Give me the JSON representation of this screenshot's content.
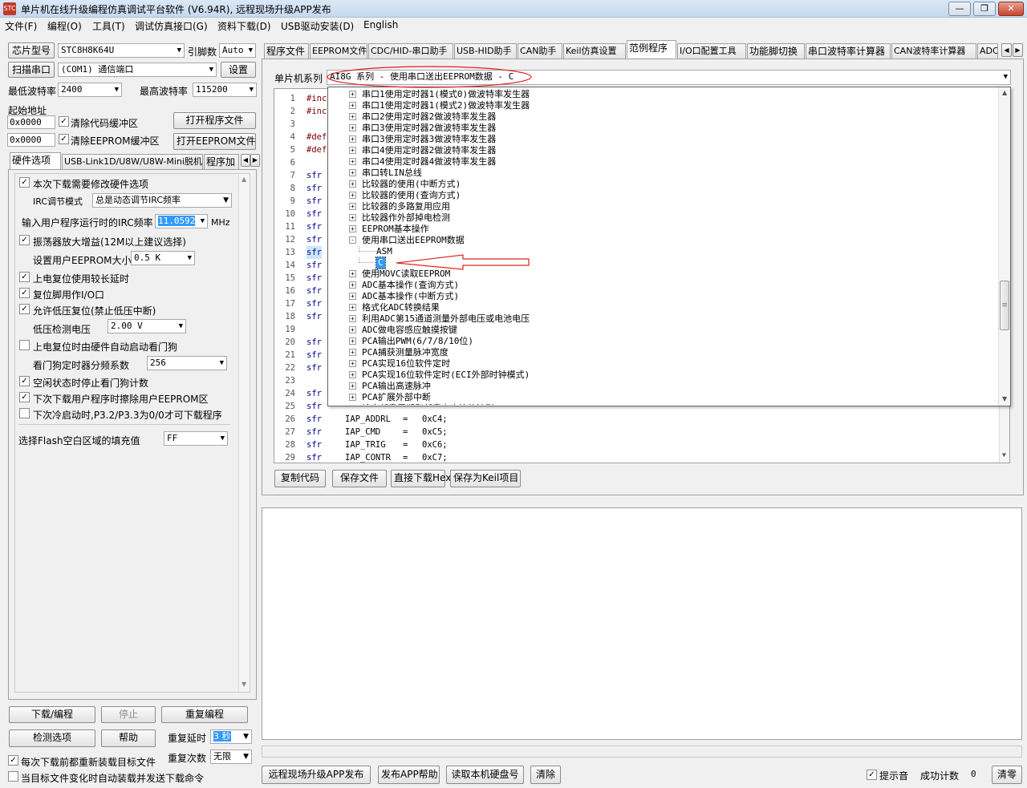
{
  "window": {
    "title": "单片机在线升级编程仿真调试平台软件 (V6.94R), 远程现场升级APP发布",
    "icon": "stc-app-icon"
  },
  "menu": [
    "文件(F)",
    "编程(O)",
    "工具(T)",
    "调试仿真接口(G)",
    "资料下载(D)",
    "USB驱动安装(D)",
    "English"
  ],
  "left": {
    "chip_label": "芯片型号",
    "chip_value": "STC8H8K64U",
    "pins_label": "引脚数",
    "pins_value": "Auto",
    "scan_label": "扫描串口",
    "port_value": "(COM1) 通信端口",
    "settings_label": "设置",
    "min_baud_label": "最低波特率",
    "min_baud": "2400",
    "max_baud_label": "最高波特率",
    "max_baud": "115200",
    "start_addr_label": "起始地址",
    "addr1": "0x0000",
    "clear_code": "清除代码缓冲区",
    "open_prog": "打开程序文件",
    "addr2": "0x0000",
    "clear_eeprom": "清除EEPROM缓冲区",
    "open_eeprom": "打开EEPROM文件",
    "tabs": [
      "硬件选项",
      "USB-Link1D/U8W/U8W-Mini脱机",
      "程序加"
    ],
    "opt_modify": "本次下载需要修改硬件选项",
    "irc_mode_label": "IRC调节模式",
    "irc_mode": "总是动态调节IRC频率",
    "irc_freq_label": "输入用户程序运行时的IRC频率",
    "irc_freq": "11.0592",
    "mhz": "MHz",
    "osc_gain": "振荡器放大增益(12M以上建议选择)",
    "eeprom_size_label": "设置用户EEPROM大小",
    "eeprom_size": "0.5 K",
    "opt_long_delay": "上电复位使用较长延时",
    "opt_reset_io": "复位脚用作I/O口",
    "opt_lvr": "允许低压复位(禁止低压中断)",
    "lvd_label": "低压检测电压",
    "lvd": "2.00 V",
    "opt_wdt": "上电复位时由硬件自动启动看门狗",
    "wdt_div_label": "看门狗定时器分频系数",
    "wdt_div": "256",
    "opt_idle_wdt": "空闲状态时停止看门狗计数",
    "opt_erase_eeprom": "下次下载用户程序时擦除用户EEPROM区",
    "opt_p32": "下次冷启动时,P3.2/P3.3为0/0才可下载程序",
    "fill_label": "选择Flash空白区域的填充值",
    "fill": "FF",
    "download": "下载/编程",
    "stop": "停止",
    "reprogram": "重复编程",
    "check": "检测选项",
    "help": "帮助",
    "repeat_delay_label": "重复延时",
    "repeat_delay": "3 秒",
    "repeat_count_label": "重复次数",
    "repeat_count": "无限",
    "reload_each": "每次下载前都重新装载目标文件",
    "auto_reload": "当目标文件变化时自动装载并发送下载命令"
  },
  "right_tabs": [
    "程序文件",
    "EEPROM文件",
    "CDC/HID-串口助手",
    "USB-HID助手",
    "CAN助手",
    "Keil仿真设置",
    "范例程序",
    "I/O口配置工具",
    "功能脚切换",
    "串口波特率计算器",
    "CAN波特率计算器",
    "ADC"
  ],
  "examples": {
    "series_label": "单片机系列",
    "series_value": "AI8G 系列 - 使用串口送出EEPROM数据 - C",
    "tree": [
      {
        "t": "串口1使用定时器1(模式0)做波特率发生器",
        "exp": "+"
      },
      {
        "t": "串口1使用定时器1(模式2)做波特率发生器",
        "exp": "+"
      },
      {
        "t": "串口2使用定时器2做波特率发生器",
        "exp": "+"
      },
      {
        "t": "串口3使用定时器2做波特率发生器",
        "exp": "+"
      },
      {
        "t": "串口3使用定时器3做波特率发生器",
        "exp": "+"
      },
      {
        "t": "串口4使用定时器2做波特率发生器",
        "exp": "+"
      },
      {
        "t": "串口4使用定时器4做波特率发生器",
        "exp": "+"
      },
      {
        "t": "串口转LIN总线",
        "exp": "+"
      },
      {
        "t": "比较器的使用(中断方式)",
        "exp": "+"
      },
      {
        "t": "比较器的使用(查询方式)",
        "exp": "+"
      },
      {
        "t": "比较器的多路复用应用",
        "exp": "+"
      },
      {
        "t": "比较器作外部掉电检测",
        "exp": "+"
      },
      {
        "t": "EEPROM基本操作",
        "exp": "+"
      },
      {
        "t": "使用串口送出EEPROM数据",
        "exp": "-"
      },
      {
        "t": "ASM",
        "exp": "",
        "child": true
      },
      {
        "t": "C",
        "exp": "",
        "child": true,
        "sel": true
      },
      {
        "t": "使用MOVC读取EEPROM",
        "exp": "+"
      },
      {
        "t": "ADC基本操作(查询方式)",
        "exp": "+"
      },
      {
        "t": "ADC基本操作(中断方式)",
        "exp": "+"
      },
      {
        "t": "格式化ADC转换结果",
        "exp": "+"
      },
      {
        "t": "利用ADC第15通道测量外部电压或电池电压",
        "exp": "+"
      },
      {
        "t": "ADC做电容感应触摸按键",
        "exp": "+"
      },
      {
        "t": "PCA输出PWM(6/7/8/10位)",
        "exp": "+"
      },
      {
        "t": "PCA捕获测量脉冲宽度",
        "exp": "+"
      },
      {
        "t": "PCA实现16位软件定时",
        "exp": "+"
      },
      {
        "t": "PCA实现16位软件定时(ECI外部时钟模式)",
        "exp": "+"
      },
      {
        "t": "PCA输出高速脉冲",
        "exp": "+"
      },
      {
        "t": "PCA扩展外部中断",
        "exp": "+"
      },
      {
        "t": "输出任意周期和任意占空比的波形",
        "exp": "+"
      }
    ],
    "code_lines": [
      {
        "n": "1",
        "t": "#inc",
        "c": "pp"
      },
      {
        "n": "2",
        "t": "#inc",
        "c": "pp"
      },
      {
        "n": "3",
        "t": ""
      },
      {
        "n": "4",
        "t": "#def",
        "c": "pp"
      },
      {
        "n": "5",
        "t": "#def",
        "c": "pp"
      },
      {
        "n": "6",
        "t": ""
      },
      {
        "n": "7",
        "t": "sfr",
        "c": "sfr"
      },
      {
        "n": "8",
        "t": "sfr",
        "c": "sfr"
      },
      {
        "n": "9",
        "t": "sfr",
        "c": "sfr"
      },
      {
        "n": "10",
        "t": "sfr",
        "c": "sfr"
      },
      {
        "n": "11",
        "t": "sfr",
        "c": "sfr"
      },
      {
        "n": "12",
        "t": "sfr",
        "c": "sfr"
      },
      {
        "n": "13",
        "t": "sfr",
        "c": "sfr",
        "hl": true
      },
      {
        "n": "14",
        "t": "sfr",
        "c": "sfr"
      },
      {
        "n": "15",
        "t": "sfr",
        "c": "sfr"
      },
      {
        "n": "16",
        "t": "sfr",
        "c": "sfr"
      },
      {
        "n": "17",
        "t": "sfr",
        "c": "sfr"
      },
      {
        "n": "18",
        "t": "sfr",
        "c": "sfr"
      },
      {
        "n": "19",
        "t": ""
      },
      {
        "n": "20",
        "t": "sfr",
        "c": "sfr"
      },
      {
        "n": "21",
        "t": "sfr",
        "c": "sfr"
      },
      {
        "n": "22",
        "t": "sfr",
        "c": "sfr"
      },
      {
        "n": "23",
        "t": ""
      },
      {
        "n": "24",
        "t": "sfr",
        "c": "sfr"
      },
      {
        "n": "25",
        "t": "sfr",
        "c": "sfr"
      },
      {
        "n": "26",
        "t": "sfr",
        "c": "sfr",
        "name": "IAP_ADDRL",
        "val": "0xC4;"
      },
      {
        "n": "27",
        "t": "sfr",
        "c": "sfr",
        "name": "IAP_CMD",
        "val": "0xC5;"
      },
      {
        "n": "28",
        "t": "sfr",
        "c": "sfr",
        "name": "IAP_TRIG",
        "val": "0xC6;"
      },
      {
        "n": "29",
        "t": "sfr",
        "c": "sfr",
        "name": "IAP_CONTR",
        "val": "0xC7;"
      }
    ],
    "eq": "=",
    "copy_code": "复制代码",
    "save_file": "保存文件",
    "direct_download": "直接下载Hex",
    "save_keil": "保存为Keil项目"
  },
  "bottom": {
    "publish": "远程现场升级APP发布",
    "publish_help": "发布APP帮助",
    "read_disk": "读取本机硬盘号",
    "clear": "清除",
    "beep": "提示音",
    "success_label": "成功计数",
    "success_count": "0",
    "reset": "清零"
  }
}
